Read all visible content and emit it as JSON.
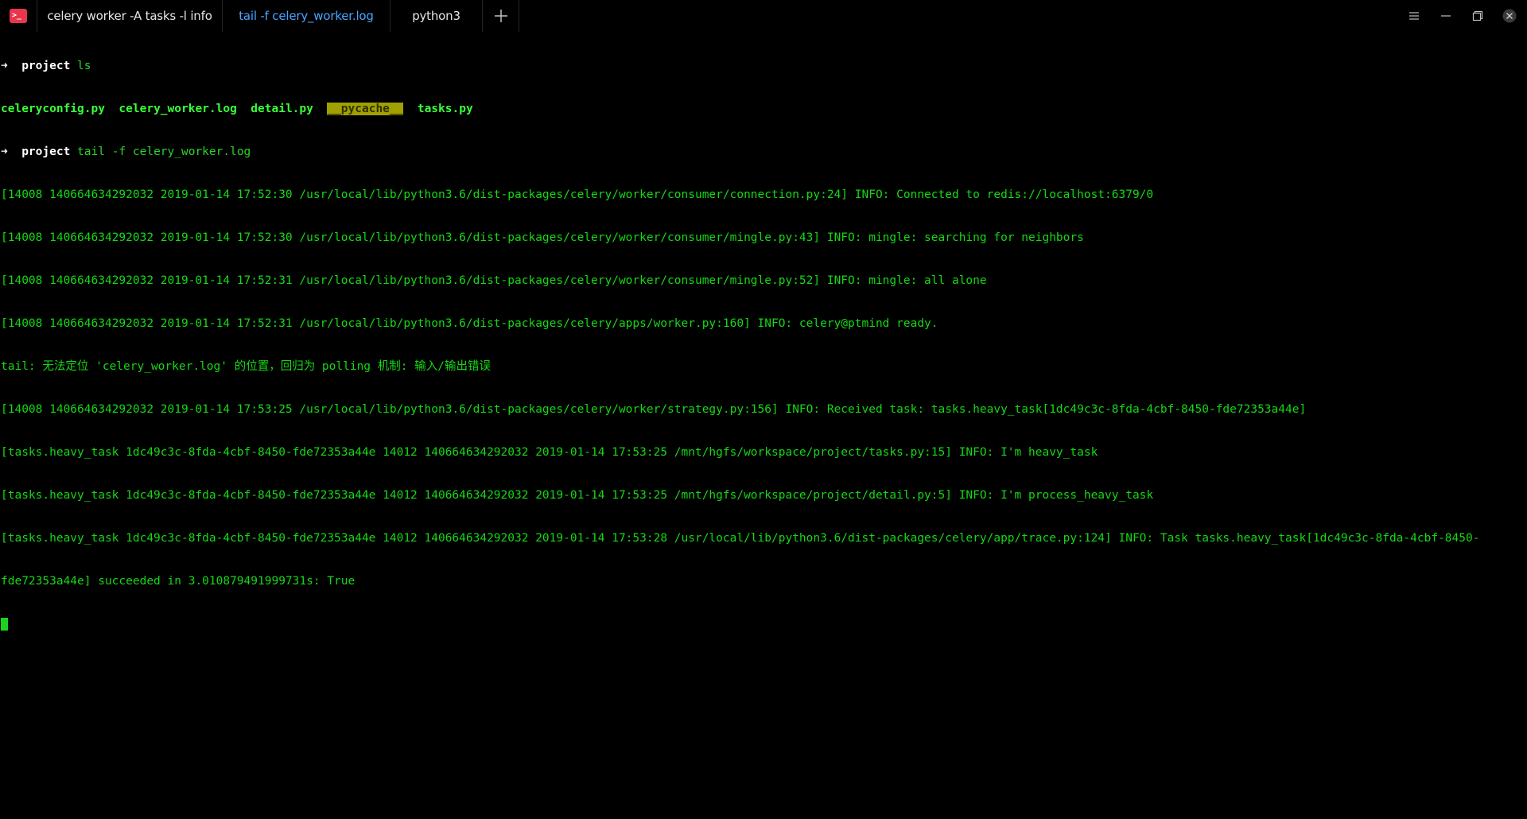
{
  "tabs": [
    {
      "label": "celery worker -A tasks -l info",
      "active": false
    },
    {
      "label": "tail -f celery_worker.log",
      "active": true
    },
    {
      "label": "python3",
      "active": false
    }
  ],
  "colors": {
    "accent_tab": "#4aa3ff",
    "terminal_text": "#15d815",
    "app_icon": "#e8364d",
    "pycache_bg": "#a0a000"
  },
  "icons": {
    "app": "terminal-icon",
    "add_tab": "plus-icon",
    "menu": "hamburger-menu-icon",
    "minimize": "minimize-icon",
    "restore": "restore-icon",
    "close": "close-icon"
  },
  "terminal": {
    "prompt1": {
      "arrow": "➜",
      "dir": "project",
      "command": "ls"
    },
    "ls_output": [
      "celeryconfig.py",
      "celery_worker.log",
      "detail.py",
      "__pycache__",
      "tasks.py"
    ],
    "prompt2": {
      "arrow": "➜",
      "dir": "project",
      "command": "tail -f celery_worker.log"
    },
    "log_lines": [
      "[14008 140664634292032 2019-01-14 17:52:30 /usr/local/lib/python3.6/dist-packages/celery/worker/consumer/connection.py:24] INFO: Connected to redis://localhost:6379/0",
      "[14008 140664634292032 2019-01-14 17:52:30 /usr/local/lib/python3.6/dist-packages/celery/worker/consumer/mingle.py:43] INFO: mingle: searching for neighbors",
      "[14008 140664634292032 2019-01-14 17:52:31 /usr/local/lib/python3.6/dist-packages/celery/worker/consumer/mingle.py:52] INFO: mingle: all alone",
      "[14008 140664634292032 2019-01-14 17:52:31 /usr/local/lib/python3.6/dist-packages/celery/apps/worker.py:160] INFO: celery@ptmind ready.",
      "tail: 无法定位 'celery_worker.log' 的位置，回归为 polling 机制: 输入/输出错误",
      "[14008 140664634292032 2019-01-14 17:53:25 /usr/local/lib/python3.6/dist-packages/celery/worker/strategy.py:156] INFO: Received task: tasks.heavy_task[1dc49c3c-8fda-4cbf-8450-fde72353a44e]",
      "[tasks.heavy_task 1dc49c3c-8fda-4cbf-8450-fde72353a44e 14012 140664634292032 2019-01-14 17:53:25 /mnt/hgfs/workspace/project/tasks.py:15] INFO: I'm heavy_task",
      "[tasks.heavy_task 1dc49c3c-8fda-4cbf-8450-fde72353a44e 14012 140664634292032 2019-01-14 17:53:25 /mnt/hgfs/workspace/project/detail.py:5] INFO: I'm process_heavy_task",
      "[tasks.heavy_task 1dc49c3c-8fda-4cbf-8450-fde72353a44e 14012 140664634292032 2019-01-14 17:53:28 /usr/local/lib/python3.6/dist-packages/celery/app/trace.py:124] INFO: Task tasks.heavy_task[1dc49c3c-8fda-4cbf-8450-",
      "fde72353a44e] succeeded in 3.010879491999731s: True"
    ]
  }
}
